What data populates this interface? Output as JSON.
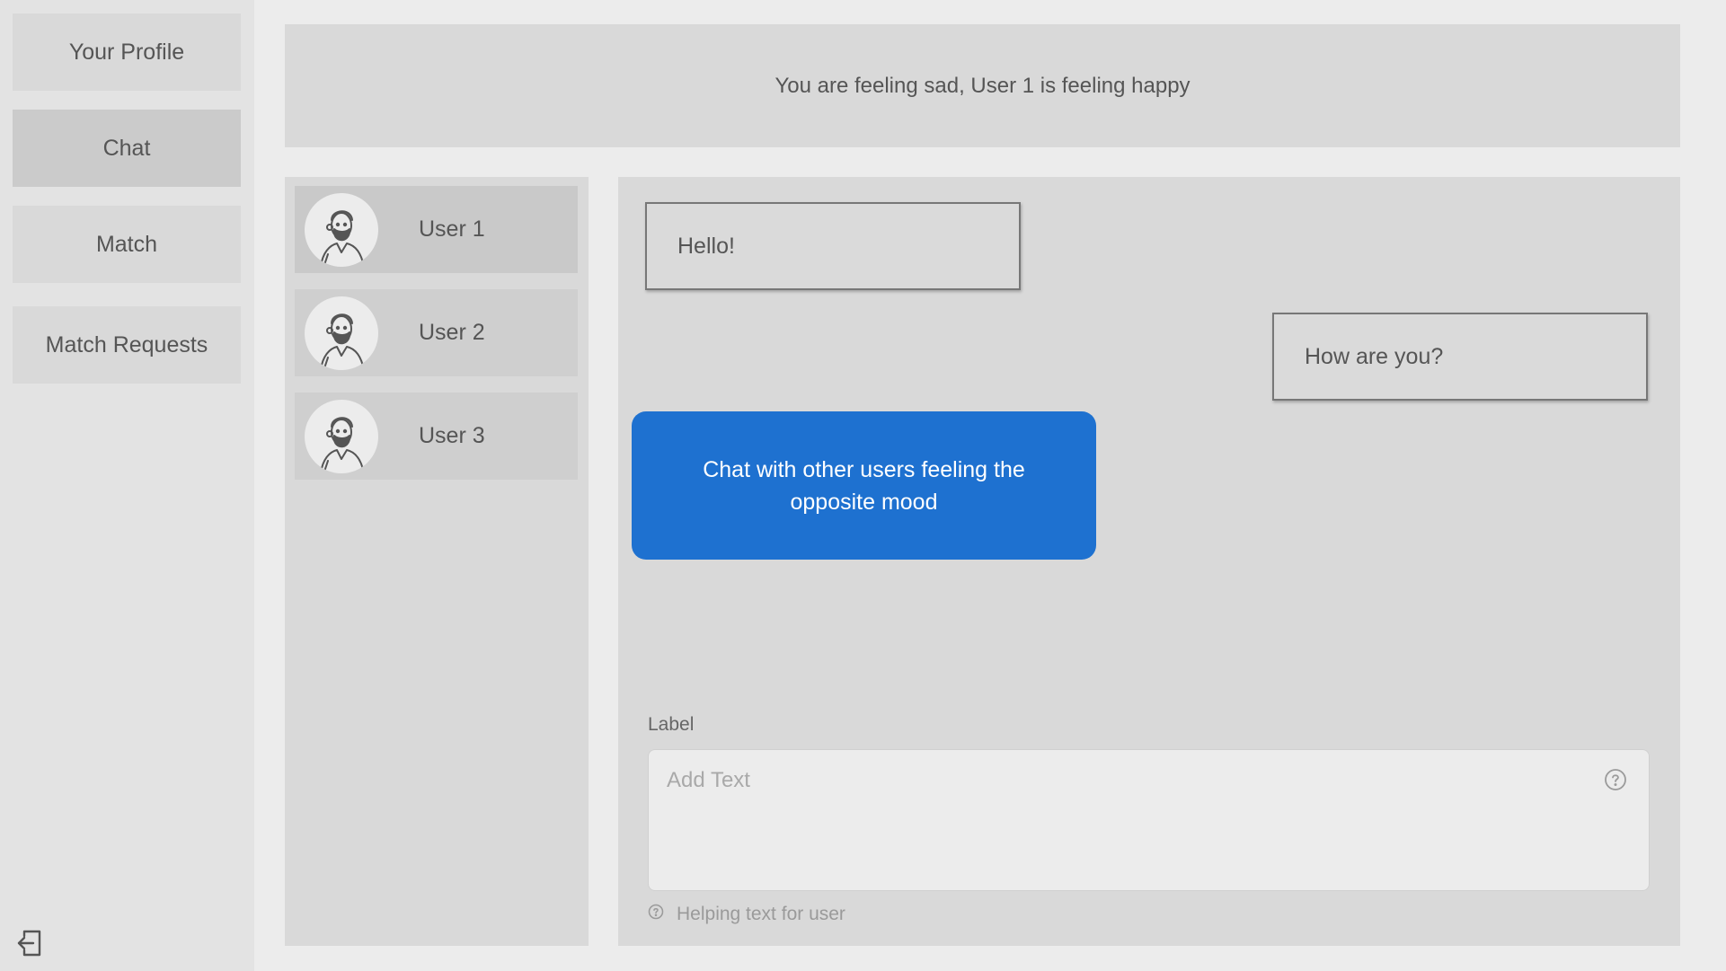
{
  "sidebar": {
    "items": [
      {
        "label": "Your Profile"
      },
      {
        "label": "Chat"
      },
      {
        "label": "Match"
      },
      {
        "label": "Match Requests"
      }
    ],
    "logout_icon": "logout-icon"
  },
  "banner": {
    "text": "You are feeling sad, User 1 is feeling happy"
  },
  "users": [
    {
      "name": "User 1"
    },
    {
      "name": "User 2"
    },
    {
      "name": "User 3"
    }
  ],
  "chat": {
    "messages": [
      {
        "text": "Hello!"
      },
      {
        "text": "How are you?"
      }
    ],
    "tooltip": "Chat with other users feeling the opposite mood",
    "input": {
      "label": "Label",
      "placeholder": "Add Text",
      "helper_text": "Helping text for user"
    }
  },
  "colors": {
    "accent": "#1e71d0",
    "panel": "#d9d9d9",
    "background": "#ececec"
  }
}
